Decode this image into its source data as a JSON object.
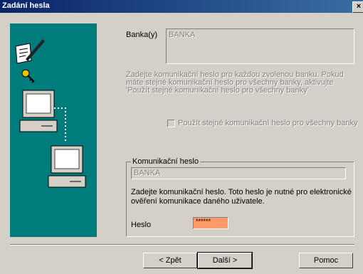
{
  "window": {
    "title": "Zadání hesla",
    "close_label": "×"
  },
  "bank": {
    "label": "Banka(y)",
    "value": "BANKA"
  },
  "info_text": "Zadejte komunikační heslo pro každou zvolenou banku. Pokud máte stejné komunikační heslo pro všechny banky, aktivujte 'Použít stejné komunikační heslo pro všechny banky'",
  "same_password_checkbox": {
    "label": "Použít stejné komunikační heslo pro všechny banky",
    "checked": false
  },
  "comm_group": {
    "title": "Komunikační heslo",
    "bank_value": "BANKA",
    "description": "Zadejte komunikační heslo. Toto heslo je nutné pro elektronické ověření komunikace daného uživatele.",
    "password_label": "Heslo",
    "password_value": "******"
  },
  "buttons": {
    "back": "< Zpět",
    "next": "Další >",
    "help": "Pomoc"
  },
  "colors": {
    "titlebar": "#0a246a",
    "art_bg": "#007c7c",
    "password_bg": "#ff9966"
  }
}
